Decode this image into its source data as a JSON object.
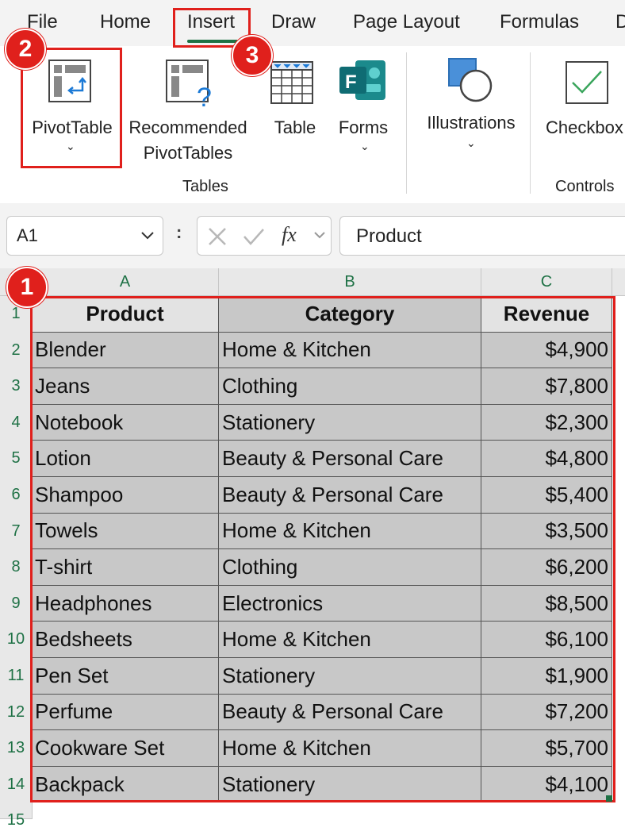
{
  "menu": {
    "tabs": [
      "File",
      "Home",
      "Insert",
      "Draw",
      "Page Layout",
      "Formulas",
      "D"
    ]
  },
  "ribbon": {
    "pivottable": "PivotTable",
    "recommended_1": "Recommended",
    "recommended_2": "PivotTables",
    "table": "Table",
    "forms": "Forms",
    "illustrations": "Illustrations",
    "checkbox": "Checkbox",
    "group_tables": "Tables",
    "group_controls": "Controls",
    "chevron": "⌄"
  },
  "formula_bar": {
    "name_box": "A1",
    "fx": "fx",
    "content": "Product",
    "colon": ":"
  },
  "grid": {
    "columns": [
      "A",
      "B",
      "C"
    ],
    "header": [
      "Product",
      "Category",
      "Revenue"
    ],
    "rows": [
      [
        "Blender",
        "Home & Kitchen",
        "$4,900"
      ],
      [
        "Jeans",
        "Clothing",
        "$7,800"
      ],
      [
        "Notebook",
        "Stationery",
        "$2,300"
      ],
      [
        "Lotion",
        "Beauty & Personal Care",
        "$4,800"
      ],
      [
        "Shampoo",
        "Beauty & Personal Care",
        "$5,400"
      ],
      [
        "Towels",
        "Home & Kitchen",
        "$3,500"
      ],
      [
        "T-shirt",
        "Clothing",
        "$6,200"
      ],
      [
        "Headphones",
        "Electronics",
        "$8,500"
      ],
      [
        "Bedsheets",
        "Home & Kitchen",
        "$6,100"
      ],
      [
        "Pen Set",
        "Stationery",
        "$1,900"
      ],
      [
        "Perfume",
        "Beauty & Personal Care",
        "$7,200"
      ],
      [
        "Cookware Set",
        "Home & Kitchen",
        "$5,700"
      ],
      [
        "Backpack",
        "Stationery",
        "$4,100"
      ]
    ],
    "row_numbers": [
      "1",
      "2",
      "3",
      "4",
      "5",
      "6",
      "7",
      "8",
      "9",
      "10",
      "11",
      "12",
      "13",
      "14",
      "15"
    ]
  },
  "callouts": [
    "1",
    "2",
    "3"
  ],
  "colors": {
    "accent_green": "#1e7145",
    "callout_red": "#e0201c",
    "selection_gray": "#c8c8c8"
  }
}
